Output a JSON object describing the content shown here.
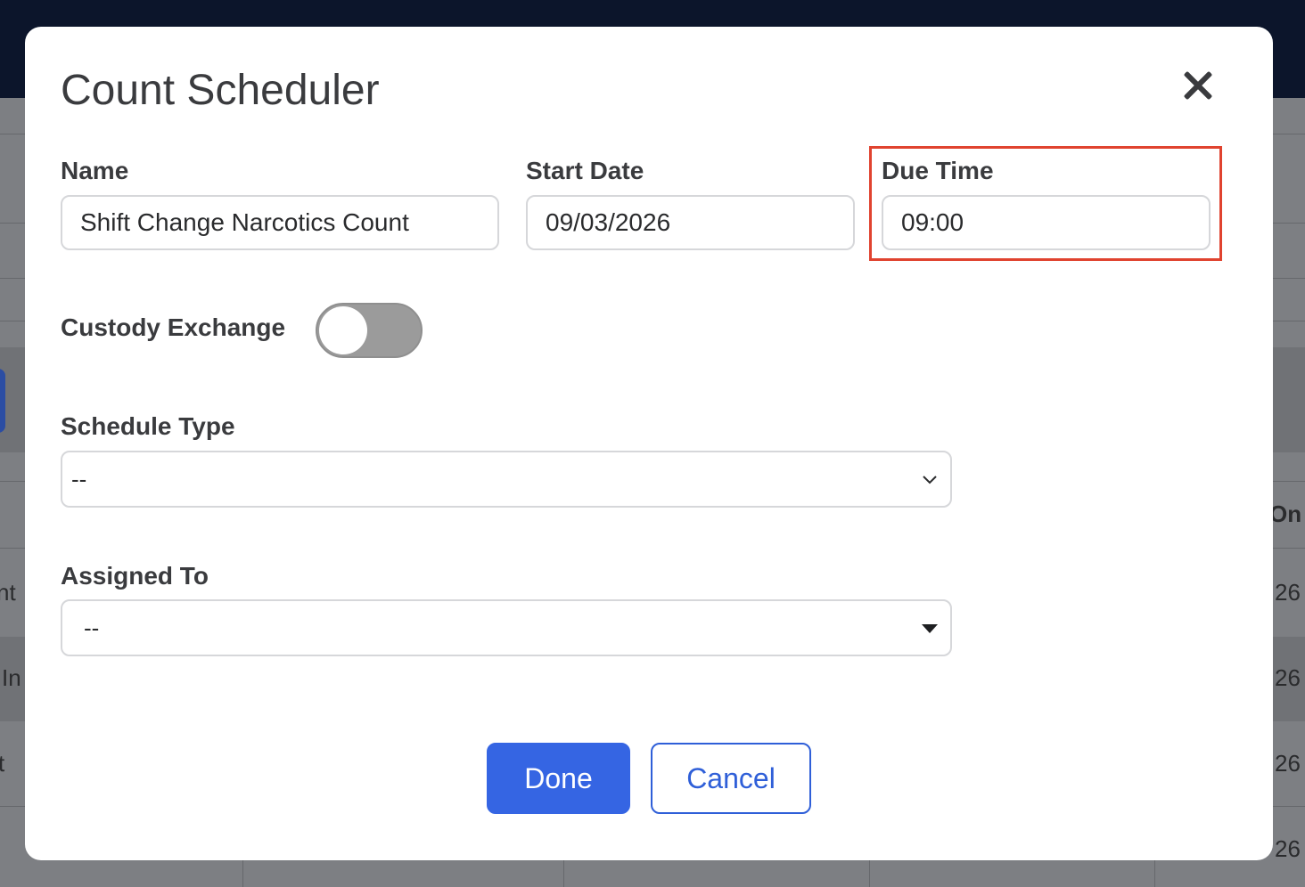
{
  "background": {
    "fragments": [
      "On",
      "nt",
      "26",
      "In",
      "26",
      "t",
      "26",
      "26"
    ]
  },
  "modal": {
    "title": "Count Scheduler",
    "close_icon": "close-icon"
  },
  "form": {
    "name": {
      "label": "Name",
      "value": "Shift Change Narcotics Count"
    },
    "start_date": {
      "label": "Start Date",
      "value": "09/03/2026"
    },
    "due_time": {
      "label": "Due Time",
      "value": "09:00",
      "highlighted": true
    },
    "custody_exchange": {
      "label": "Custody Exchange",
      "enabled": false
    },
    "schedule_type": {
      "label": "Schedule Type",
      "value": "--"
    },
    "assigned_to": {
      "label": "Assigned To",
      "value": "--"
    }
  },
  "actions": {
    "done_label": "Done",
    "cancel_label": "Cancel"
  },
  "colors": {
    "primary": "#3565e3",
    "highlight": "#e0432f",
    "toggle_off": "#9b9b9b",
    "topbar": "#0c152b"
  }
}
